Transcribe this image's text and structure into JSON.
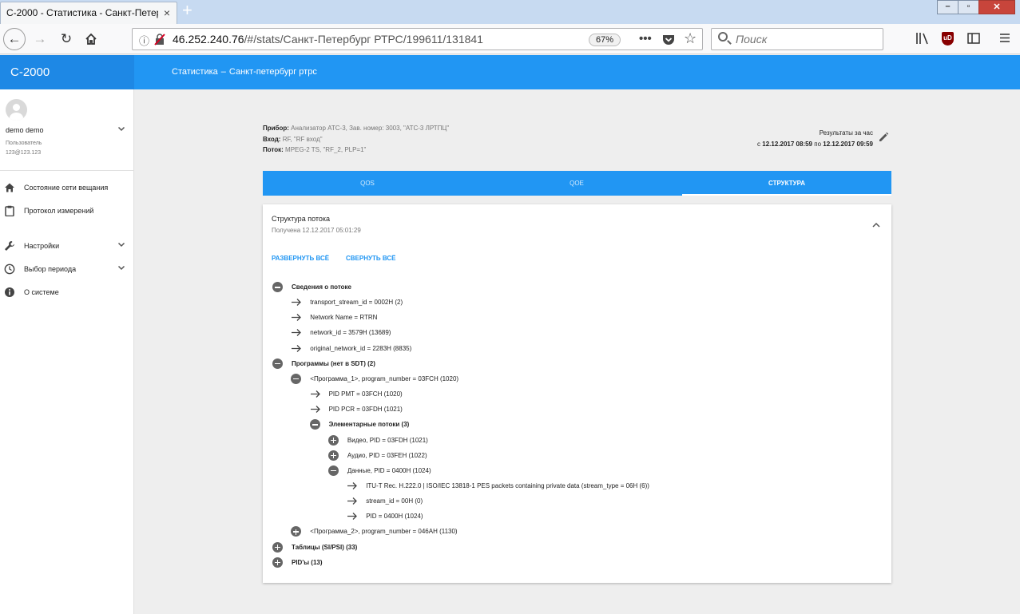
{
  "browser": {
    "tab_title": "С-2000 - Статистика - Санкт-Петер",
    "tab_close": "×",
    "new_tab": "+",
    "url_host": "46.252.240.76",
    "url_path": "/#/stats/Санкт-Петербург РТРС/199611/131841",
    "zoom": "67%",
    "search_placeholder": "Поиск",
    "icons": [
      "back-icon",
      "forward-icon",
      "reload-icon",
      "home-icon",
      "info-icon",
      "insecure-lock-icon",
      "more-icon",
      "pocket-icon",
      "bookmark-star-icon",
      "search-icon",
      "library-icon",
      "ublock-icon",
      "sidebar-icon",
      "menu-icon"
    ]
  },
  "app": {
    "brand": "С-2000",
    "page_title": "Статистика",
    "page_title_sep": "–",
    "page_subtitle": "Санкт-петербург ртрс",
    "accent_color": "#2196f3"
  },
  "sidebar": {
    "user_name": "demo demo",
    "user_role": "Пользователь",
    "user_login": "123@123.123",
    "items": [
      {
        "label": "Состояние сети вещания",
        "icon": "home-icon"
      },
      {
        "label": "Протокол измерений",
        "icon": "clipboard-icon"
      },
      {
        "label": "Настройки",
        "icon": "wrench-icon"
      },
      {
        "label": "Выбор периода",
        "icon": "clock-icon"
      },
      {
        "label": "О системе",
        "icon": "info-icon"
      }
    ]
  },
  "info": {
    "device_label": "Прибор:",
    "device_value": "Анализатор АТС-3, Зав. номер: 3003, \"АТС-3 ЛРТПЦ\"",
    "input_label": "Вход:",
    "input_value": "RF, \"RF вход\"",
    "stream_label": "Поток:",
    "stream_value": "MPEG-2 TS, \"RF_2, PLP=1\"",
    "period_title": "Результаты за час",
    "period_from_word": "с",
    "period_from": "12.12.2017 08:59",
    "period_to_word": "по",
    "period_to": "12.12.2017 09:59"
  },
  "tabs": [
    {
      "label": "QOS",
      "active": false
    },
    {
      "label": "QOE",
      "active": false
    },
    {
      "label": "СТРУКТУРА",
      "active": true
    }
  ],
  "card": {
    "title": "Структура потока",
    "subtitle": "Получена 12.12.2017 05:01:29",
    "expand_all": "РАЗВЕРНУТЬ ВСЁ",
    "collapse_all": "СВЕРНУТЬ ВСЁ"
  },
  "tree": [
    {
      "level": 0,
      "type": "minus",
      "bold": true,
      "text": "Сведения о потоке"
    },
    {
      "level": 1,
      "type": "leaf",
      "bold": false,
      "text": "transport_stream_id = 0002H (2)"
    },
    {
      "level": 1,
      "type": "leaf",
      "bold": false,
      "text": "Network Name = RTRN"
    },
    {
      "level": 1,
      "type": "leaf",
      "bold": false,
      "text": "network_id = 3579H (13689)"
    },
    {
      "level": 1,
      "type": "leaf",
      "bold": false,
      "text": "original_network_id = 2283H (8835)"
    },
    {
      "level": 0,
      "type": "minus",
      "bold": true,
      "text": "Программы (нет в SDT) (2)"
    },
    {
      "level": 1,
      "type": "minus",
      "bold": false,
      "text": "<Программа_1>, program_number = 03FCH (1020)"
    },
    {
      "level": 2,
      "type": "leaf",
      "bold": false,
      "text": "PID PMT = 03FCH (1020)"
    },
    {
      "level": 2,
      "type": "leaf",
      "bold": false,
      "text": "PID PCR = 03FDH (1021)"
    },
    {
      "level": 2,
      "type": "minus",
      "bold": true,
      "text": "Элементарные потоки (3)"
    },
    {
      "level": 3,
      "type": "plus",
      "bold": false,
      "text": "Видео, PID = 03FDH (1021)"
    },
    {
      "level": 3,
      "type": "plus",
      "bold": false,
      "text": "Аудио, PID = 03FEH (1022)"
    },
    {
      "level": 3,
      "type": "minus",
      "bold": false,
      "text": "Данные, PID = 0400H (1024)"
    },
    {
      "level": 4,
      "type": "leaf",
      "bold": false,
      "text": "ITU-T Rec. H.222.0 | ISO/IEC 13818-1 PES packets containing private data (stream_type = 06H (6))"
    },
    {
      "level": 4,
      "type": "leaf",
      "bold": false,
      "text": "stream_id = 00H (0)"
    },
    {
      "level": 4,
      "type": "leaf",
      "bold": false,
      "text": "PID = 0400H (1024)"
    },
    {
      "level": 1,
      "type": "plus",
      "bold": false,
      "text": "<Программа_2>, program_number = 046AH (1130)"
    },
    {
      "level": 0,
      "type": "plus",
      "bold": true,
      "text": "Таблицы (SI/PSI) (33)"
    },
    {
      "level": 0,
      "type": "plus",
      "bold": true,
      "text": "PID'ы (13)"
    }
  ]
}
